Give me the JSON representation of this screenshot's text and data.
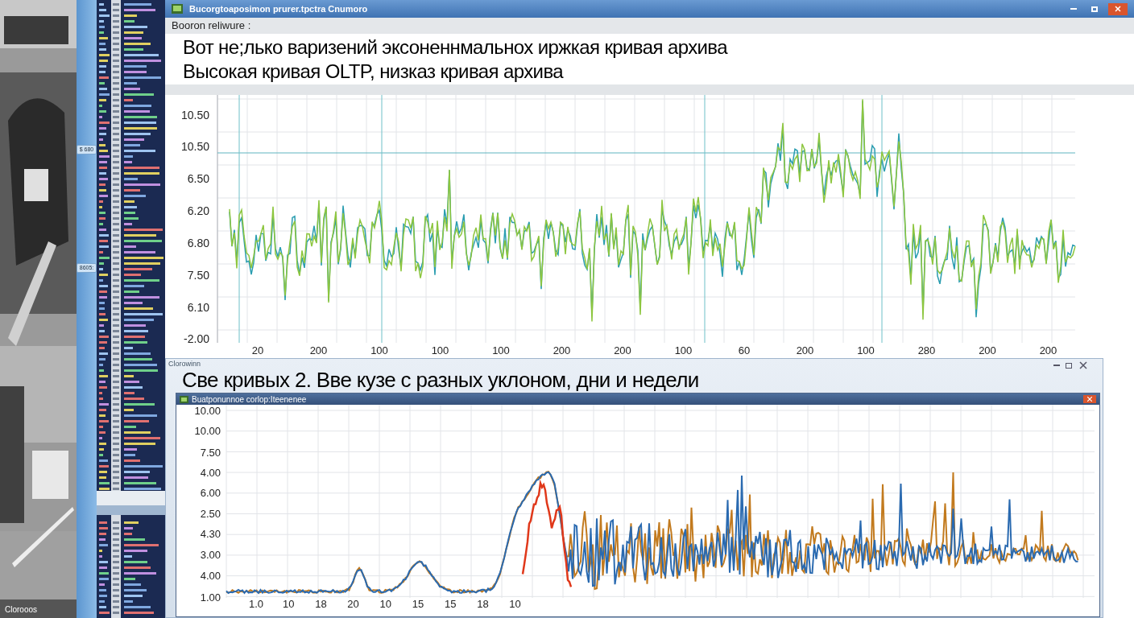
{
  "sidebar": {
    "badges": [
      "$ 680",
      "8605:"
    ],
    "footer": "Clorooos"
  },
  "main_window": {
    "title": "Bucorgtoaposimon prurer.tpctra Cnumoro",
    "subtitle": "Booron reliwure :",
    "headline_lines": [
      "Вот не;лько варизений эксоненнмальнох иржкая кривая архива",
      "Высокая кривая OLTP, низказ кривая архива"
    ],
    "chart": {
      "y_ticks": [
        "10.50",
        "10.50",
        "6.50",
        "6.20",
        "6.80",
        "7.50",
        "6.10",
        "-2.00"
      ],
      "x_labels": [
        "20",
        "200",
        "100",
        "100",
        "100",
        "200",
        "200",
        "100",
        "60",
        "200",
        "100",
        "280",
        "200",
        "200"
      ]
    }
  },
  "overlay_window": {
    "caption": "Clorowinn",
    "headline": "Све кривых 2. Вве кузе с разных уклоном, дни и недели",
    "inner_window": {
      "title": "Buatponunnoe corlop:Iteenenee",
      "chart": {
        "y_ticks": [
          "10.00",
          "10.00",
          "7.50",
          "4.00",
          "6.00",
          "2.50",
          "4.30",
          "3.00",
          "4.00",
          "1.00"
        ],
        "x_labels": [
          "1.0",
          "10",
          "18",
          "20",
          "10",
          "15",
          "15",
          "18",
          "10"
        ]
      }
    }
  }
}
